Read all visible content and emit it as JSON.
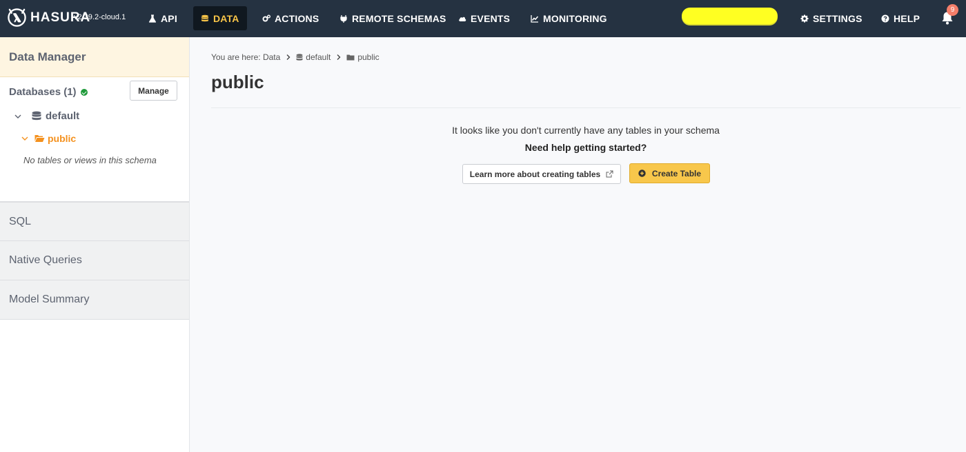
{
  "app": {
    "brand": "HASURA",
    "version": "v2.39.2-cloud.1"
  },
  "nav": {
    "api": "API",
    "data": "DATA",
    "actions": "ACTIONS",
    "remote_schemas": "REMOTE SCHEMAS",
    "events": "EVENTS",
    "monitoring": "MONITORING",
    "settings": "SETTINGS",
    "help": "HELP",
    "notification_count": "9",
    "active_color": "#f9c548",
    "highlight_color": "#ffff22"
  },
  "sidebar": {
    "header": "Data Manager",
    "databases_label": "Databases (1)",
    "manage_label": "Manage",
    "db_name": "default",
    "schema_name": "public",
    "empty_note": "No tables or views in this schema",
    "items": [
      {
        "label": "SQL"
      },
      {
        "label": "Native Queries"
      },
      {
        "label": "Model Summary"
      }
    ]
  },
  "main": {
    "breadcrumb": {
      "prefix": "You are here: Data",
      "db": "default",
      "schema": "public"
    },
    "title": "public",
    "empty_message": "It looks like you don't currently have any tables in your schema",
    "help_heading": "Need help getting started?",
    "learn_button": "Learn more about creating tables",
    "create_button": "Create Table"
  },
  "icons": {
    "api": "flask-icon",
    "data": "database-icon",
    "actions": "cogs-icon",
    "remote_schemas": "plug-icon",
    "events": "cloud-icon",
    "monitoring": "line-chart-icon",
    "settings": "gear-icon",
    "help": "question-circle-icon",
    "notifications": "bell-icon"
  }
}
